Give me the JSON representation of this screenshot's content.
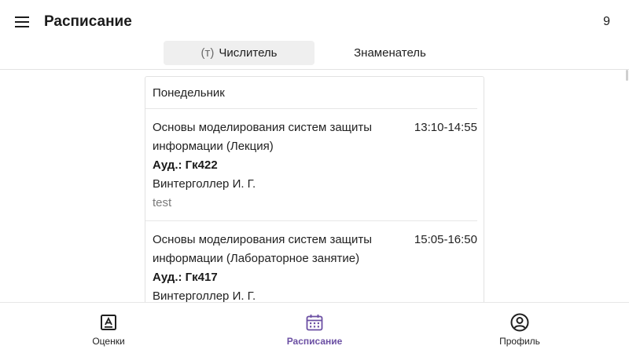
{
  "app_bar": {
    "title": "Расписание",
    "week_number": "9",
    "menu_icon": "hamburger-menu-icon"
  },
  "tabs": [
    {
      "prefix": "(т)",
      "label": "Числитель",
      "active": true
    },
    {
      "prefix": "",
      "label": "Знаменатель",
      "active": false
    }
  ],
  "schedule": {
    "day": "Понедельник",
    "lessons": [
      {
        "title": "Основы моделирования систем защиты информации (Лекция)",
        "time": "13:10-14:55",
        "room": "Ауд.: Гк422",
        "teacher": "Винтерголлер И. Г.",
        "note": "test"
      },
      {
        "title": "Основы моделирования систем защиты информации (Лабораторное занятие)",
        "time": "15:05-16:50",
        "room": "Ауд.: Гк417",
        "teacher": "Винтерголлер И. Г.",
        "note": ""
      }
    ]
  },
  "bottom_nav": {
    "accent_color": "#6b4fa3",
    "items": [
      {
        "label": "Оценки",
        "icon": "grades-icon",
        "active": false
      },
      {
        "label": "Расписание",
        "icon": "calendar-icon",
        "active": true
      },
      {
        "label": "Профиль",
        "icon": "profile-icon",
        "active": false
      }
    ]
  }
}
